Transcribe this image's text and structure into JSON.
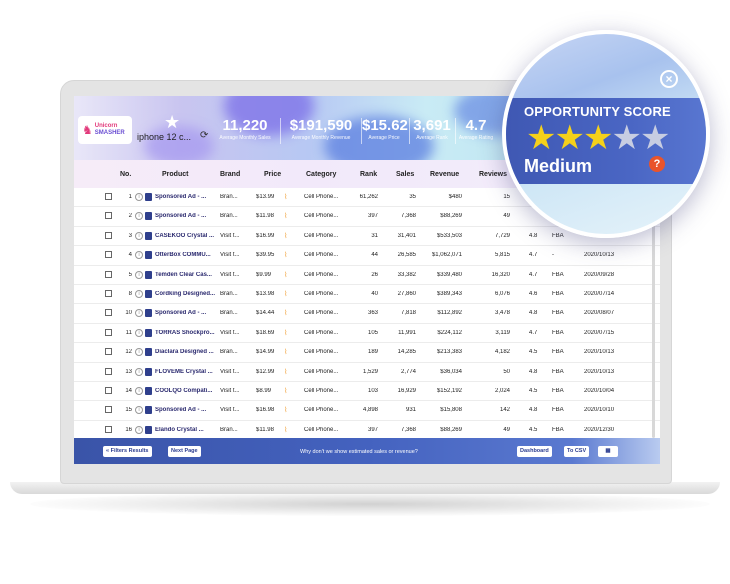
{
  "brand": {
    "line1": "Unicorn",
    "line2": "SMASHER"
  },
  "search": {
    "query": "iphone 12 c..."
  },
  "stats": [
    {
      "value": "11,220",
      "label": "Average Monthly Sales"
    },
    {
      "value": "$191,590",
      "label": "Average Monthly Revenue"
    },
    {
      "value": "$15.62",
      "label": "Average Price"
    },
    {
      "value": "3,691",
      "label": "Average Rank"
    },
    {
      "value": "4.7",
      "label": "Average Rating"
    }
  ],
  "columns": [
    "No.",
    "Product",
    "Brand",
    "Price",
    "Category",
    "Rank",
    "Sales",
    "Revenue",
    "Reviews"
  ],
  "rows": [
    {
      "no": "1",
      "product": "Sponsored Ad - ...",
      "brand": "Bran...",
      "price": "$13.99",
      "category": "Cell Phone...",
      "rank": "61,262",
      "sales": "35",
      "revenue": "$480",
      "reviews": "15",
      "rating": "",
      "seller": "",
      "date": ""
    },
    {
      "no": "2",
      "product": "Sponsored Ad - ...",
      "brand": "Bran...",
      "price": "$11.98",
      "category": "Cell Phone...",
      "rank": "397",
      "sales": "7,368",
      "revenue": "$88,269",
      "reviews": "49",
      "rating": "",
      "seller": "",
      "date": ""
    },
    {
      "no": "3",
      "product": "CASEKOO Crystal ...",
      "brand": "Visit t...",
      "price": "$16.99",
      "category": "Cell Phone...",
      "rank": "31",
      "sales": "31,401",
      "revenue": "$533,503",
      "reviews": "7,729",
      "rating": "4.8",
      "seller": "FBA",
      "date": ""
    },
    {
      "no": "4",
      "product": "OtterBox COMMU...",
      "brand": "Visit t...",
      "price": "$39.95",
      "category": "Cell Phone...",
      "rank": "44",
      "sales": "26,585",
      "revenue": "$1,062,071",
      "reviews": "5,815",
      "rating": "4.7",
      "seller": "-",
      "date": "2020/10/13"
    },
    {
      "no": "5",
      "product": "Temden Clear Cas...",
      "brand": "Visit t...",
      "price": "$9.99",
      "category": "Cell Phone...",
      "rank": "26",
      "sales": "33,382",
      "revenue": "$339,480",
      "reviews": "16,320",
      "rating": "4.7",
      "seller": "FBA",
      "date": "2020/09/28"
    },
    {
      "no": "8",
      "product": "Cordking Designed...",
      "brand": "Bran...",
      "price": "$13.98",
      "category": "Cell Phone...",
      "rank": "40",
      "sales": "27,860",
      "revenue": "$389,343",
      "reviews": "6,076",
      "rating": "4.6",
      "seller": "FBA",
      "date": "2020/07/14"
    },
    {
      "no": "10",
      "product": "Sponsored Ad - ...",
      "brand": "Bran...",
      "price": "$14.44",
      "category": "Cell Phone...",
      "rank": "363",
      "sales": "7,818",
      "revenue": "$112,892",
      "reviews": "3,478",
      "rating": "4.8",
      "seller": "FBA",
      "date": "2020/08/07"
    },
    {
      "no": "11",
      "product": "TORRAS Shockpro...",
      "brand": "Visit t...",
      "price": "$18.69",
      "category": "Cell Phone...",
      "rank": "105",
      "sales": "11,991",
      "revenue": "$224,112",
      "reviews": "3,119",
      "rating": "4.7",
      "seller": "FBA",
      "date": "2020/07/15"
    },
    {
      "no": "12",
      "product": "Diaclara Designed ...",
      "brand": "Bran...",
      "price": "$14.99",
      "category": "Cell Phone...",
      "rank": "189",
      "sales": "14,285",
      "revenue": "$213,383",
      "reviews": "4,182",
      "rating": "4.5",
      "seller": "FBA",
      "date": "2020/10/13"
    },
    {
      "no": "13",
      "product": "FLOVEME Crystal ...",
      "brand": "Visit t...",
      "price": "$12.99",
      "category": "Cell Phone...",
      "rank": "1,529",
      "sales": "2,774",
      "revenue": "$36,034",
      "reviews": "50",
      "rating": "4.8",
      "seller": "FBA",
      "date": "2020/10/13"
    },
    {
      "no": "14",
      "product": "COOLQO Compati...",
      "brand": "Visit t...",
      "price": "$8.99",
      "category": "Cell Phone...",
      "rank": "103",
      "sales": "16,929",
      "revenue": "$152,192",
      "reviews": "2,024",
      "rating": "4.5",
      "seller": "FBA",
      "date": "2020/10/04"
    },
    {
      "no": "15",
      "product": "Sponsored Ad - ...",
      "brand": "Visit t...",
      "price": "$16.98",
      "category": "Cell Phone...",
      "rank": "4,898",
      "sales": "931",
      "revenue": "$15,808",
      "reviews": "142",
      "rating": "4.8",
      "seller": "FBA",
      "date": "2020/10/10"
    },
    {
      "no": "16",
      "product": "Elando Crystal ...",
      "brand": "Bran...",
      "price": "$11.98",
      "category": "Cell Phone...",
      "rank": "397",
      "sales": "7,368",
      "revenue": "$88,269",
      "reviews": "49",
      "rating": "4.5",
      "seller": "FBA",
      "date": "2020/12/30"
    }
  ],
  "footer": {
    "filters_results": "« Filters Results",
    "next_page": "Next Page",
    "note": "Why don't we show estimated sales or revenue?",
    "dashboard": "Dashboard",
    "to_csv": "To CSV"
  },
  "opportunity": {
    "title": "OPPORTUNITY SCORE",
    "stars_filled": 3,
    "stars_total": 5,
    "level": "Medium",
    "help": "?"
  },
  "colors": {
    "accent": "#3f58b3",
    "star": "#f5d11a",
    "help": "#e9542b"
  }
}
